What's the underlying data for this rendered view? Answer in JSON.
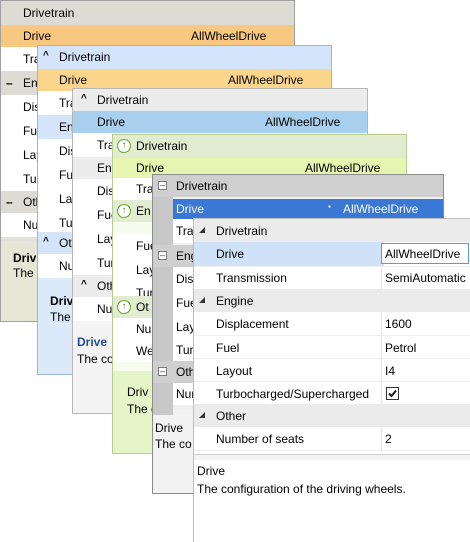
{
  "w1": {
    "cat_drivetrain": "Drivetrain",
    "drive_label": "Drive",
    "drive_value": "AllWheelDrive",
    "tra": "Tra",
    "cat_engine": "Engi",
    "dis": "Dis",
    "fue": "Fue",
    "lay": "Lay",
    "tur": "Tur",
    "cat_other": "Oth",
    "num": "Nu",
    "desc_title": "Driv",
    "desc_text": "The c"
  },
  "w2": {
    "cat_drivetrain": "Drivetrain",
    "drive_label": "Drive",
    "drive_value": "AllWheelDrive",
    "tra": "Tra",
    "cat_engine": "Eng",
    "dis": "Dis",
    "fue": "Fue",
    "lay": "Lay",
    "tur": "Tur",
    "cat_other": "Oth",
    "num": "Nu",
    "desc_title": "Drive",
    "desc_text": "The co"
  },
  "w3": {
    "cat_drivetrain": "Drivetrain",
    "drive_label": "Drive",
    "drive_value": "AllWheelDrive",
    "tra": "Tra",
    "cat_engine": "Eng",
    "dis": "Dis",
    "fue": "Fue",
    "lay": "Lay",
    "tur": "Tur",
    "cat_other": "Oth",
    "num": "Nu",
    "desc_title": "Drive",
    "desc_text": "The co"
  },
  "w4": {
    "cat_drivetrain": "Drivetrain",
    "drive_label": "Drive",
    "drive_value": "AllWheelDrive",
    "tra": "Tra",
    "cat_engine": "En",
    "fue": "Fue",
    "lay": "Lay",
    "tur": "Tur",
    "cat_other": "Ot",
    "num": "Nu",
    "we": "We",
    "desc_title": "Driv",
    "desc_text": "The c"
  },
  "w5": {
    "cat_drivetrain": "Drivetrain",
    "drive_label": "Drive",
    "drive_value": "AllWheelDrive",
    "tra": "Tra",
    "cat_engine": "Eng",
    "dis": "Dis",
    "fue": "Fue",
    "lay": "Lay",
    "tur": "Tur",
    "cat_other": "Oth",
    "num": "Nur",
    "desc_title": "Drive",
    "desc_text": "The co"
  },
  "w6": {
    "cat_drivetrain": "Drivetrain",
    "drive_label": "Drive",
    "drive_value": "AllWheelDrive",
    "transmission_label": "Transmission",
    "transmission_value": "SemiAutomatic",
    "cat_engine": "Engine",
    "displacement_label": "Displacement",
    "displacement_value": "1600",
    "fuel_label": "Fuel",
    "fuel_value": "Petrol",
    "layout_label": "Layout",
    "layout_value": "I4",
    "turbo_label": "Turbocharged/Supercharged",
    "turbo_checked": true,
    "cat_other": "Other",
    "seats_label": "Number of seats",
    "seats_value": "2",
    "splitter": "••••••••",
    "desc_title": "Drive",
    "desc_text": "The configuration of the driving wheels."
  }
}
